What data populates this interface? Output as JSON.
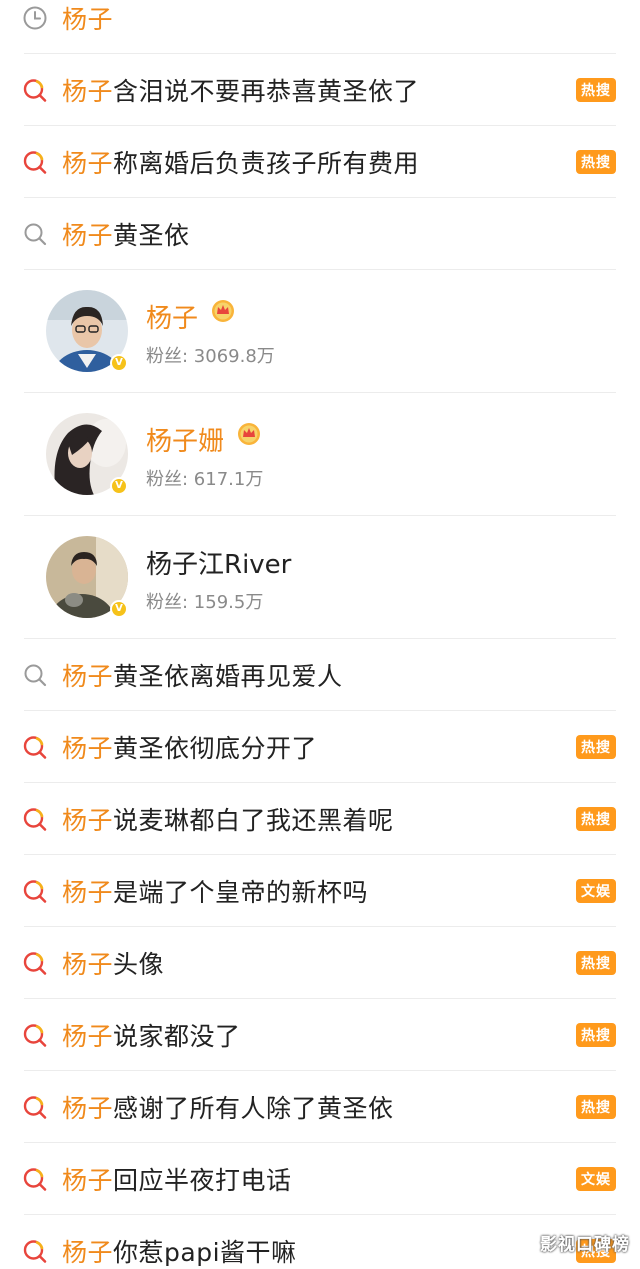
{
  "history_row": {
    "icon": "clock-icon",
    "keyword": "杨子",
    "rest": ""
  },
  "rows_top": [
    {
      "icon": "hot-search-icon",
      "keyword": "杨子",
      "rest": "含泪说不要再恭喜黄圣依了",
      "badge": "热搜"
    },
    {
      "icon": "hot-search-icon",
      "keyword": "杨子",
      "rest": "称离婚后负责孩子所有费用",
      "badge": "热搜"
    },
    {
      "icon": "search-icon",
      "keyword": "杨子",
      "rest": "黄圣依",
      "badge": ""
    }
  ],
  "users": [
    {
      "name_hl": "杨子",
      "name_rest": "",
      "crown": true,
      "fans": "粉丝: 3069.8万"
    },
    {
      "name_hl": "杨子姗",
      "name_rest": "",
      "crown": true,
      "fans": "粉丝: 617.1万"
    },
    {
      "name_hl": "",
      "name_rest": "杨子江River",
      "crown": false,
      "fans": "粉丝: 159.5万"
    }
  ],
  "verified_badge": "V",
  "rows_bottom": [
    {
      "icon": "search-icon",
      "keyword": "杨子",
      "rest": "黄圣依离婚再见爱人",
      "badge": ""
    },
    {
      "icon": "hot-search-icon",
      "keyword": "杨子",
      "rest": "黄圣依彻底分开了",
      "badge": "热搜"
    },
    {
      "icon": "hot-search-icon",
      "keyword": "杨子",
      "rest": "说麦琳都白了我还黑着呢",
      "badge": "热搜"
    },
    {
      "icon": "hot-search-icon",
      "keyword": "杨子",
      "rest": "是端了个皇帝的新杯吗",
      "badge": "文娱"
    },
    {
      "icon": "hot-search-icon",
      "keyword": "杨子",
      "rest": "头像",
      "badge": "热搜"
    },
    {
      "icon": "hot-search-icon",
      "keyword": "杨子",
      "rest": "说家都没了",
      "badge": "热搜"
    },
    {
      "icon": "hot-search-icon",
      "keyword": "杨子",
      "rest": "感谢了所有人除了黄圣依",
      "badge": "热搜"
    },
    {
      "icon": "hot-search-icon",
      "keyword": "杨子",
      "rest": "回应半夜打电话",
      "badge": "文娱"
    },
    {
      "icon": "hot-search-icon",
      "keyword": "杨子",
      "rest": "你惹papi酱干嘛",
      "badge": "热搜"
    }
  ],
  "watermark": "影视口碑榜",
  "colors": {
    "highlight": "#f08a1c",
    "badge": "#ff9a1c",
    "verified": "#f6c21a",
    "hot_icon": "#e8453c"
  }
}
